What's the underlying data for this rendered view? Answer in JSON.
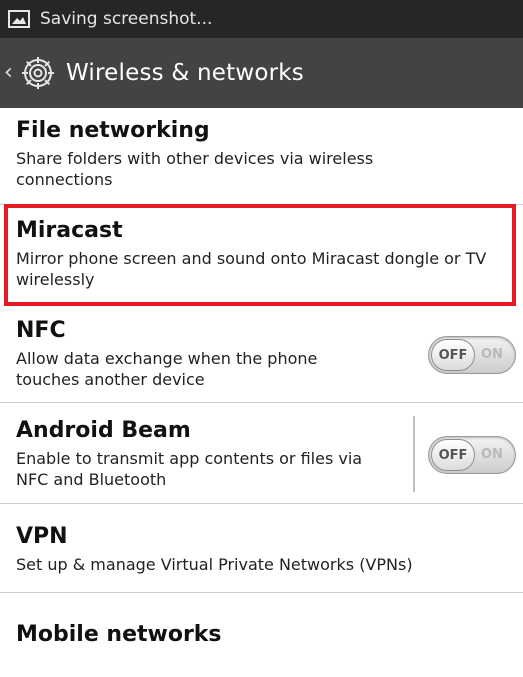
{
  "status_bar": {
    "text": "Saving screenshot..."
  },
  "action_bar": {
    "title": "Wireless & networks"
  },
  "items": [
    {
      "title": "File networking",
      "subtitle": "Share folders with other devices via wireless connections"
    },
    {
      "title": "Miracast",
      "subtitle": "Mirror phone screen and sound onto Miracast dongle or TV wirelessly"
    },
    {
      "title": "NFC",
      "subtitle": "Allow data exchange when the phone touches another device",
      "toggle": {
        "off_label": "OFF",
        "on_label": "ON",
        "state": "off"
      }
    },
    {
      "title": "Android Beam",
      "subtitle": "Enable to transmit app contents or files via NFC and Bluetooth",
      "toggle": {
        "off_label": "OFF",
        "on_label": "ON",
        "state": "off"
      }
    },
    {
      "title": "VPN",
      "subtitle": "Set up & manage Virtual Private Networks (VPNs)"
    },
    {
      "title": "Mobile networks"
    }
  ],
  "colors": {
    "status_bar": "#262626",
    "action_bar": "#434343",
    "highlight": "#e31b23"
  }
}
